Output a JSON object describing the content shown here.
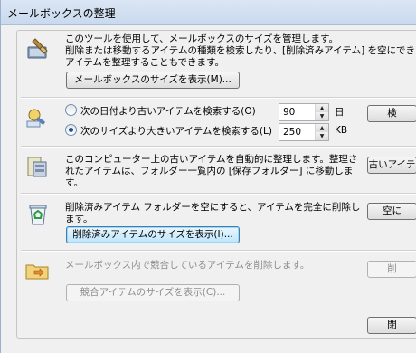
{
  "window": {
    "title": "メールボックスの整理"
  },
  "sections": {
    "mailbox_size": {
      "description_1": "このツールを使用して、メールボックスのサイズを管理します。",
      "description_2": "削除または移動するアイテムの種類を検索したり、[削除済みアイテム] を空にできま",
      "description_3": "アイテムを整理することもできます。",
      "button": "メールボックスのサイズを表示(M)..."
    },
    "search": {
      "radio_date_label": "次の日付より古いアイテムを検索する(O)",
      "radio_date_checked": false,
      "date_value": "90",
      "date_unit": "日",
      "radio_size_label": "次のサイズより大きいアイテムを検索する(L)",
      "radio_size_checked": true,
      "size_value": "250",
      "size_unit": "KB",
      "button": "検"
    },
    "archive": {
      "description_1": "このコンピューター上の古いアイテムを自動的に整理します。整理さ",
      "description_2": "れたアイテムは、フォルダー一覧内の [保存フォルダー] に移動しま",
      "description_3": "す。",
      "button": "古いアイテ"
    },
    "deleted_items": {
      "description_1": "削除済みアイテム フォルダーを空にすると、アイテムを完全に削除し",
      "description_2": "ます。",
      "button_size": "削除済みアイテムのサイズを表示(I)...",
      "button_empty": "空に"
    },
    "conflicts": {
      "description": "メールボックス内で競合しているアイテムを削除します。",
      "button_size": "競合アイテムのサイズを表示(C)...",
      "button_delete": "削"
    }
  },
  "footer": {
    "close_button": "閉"
  }
}
